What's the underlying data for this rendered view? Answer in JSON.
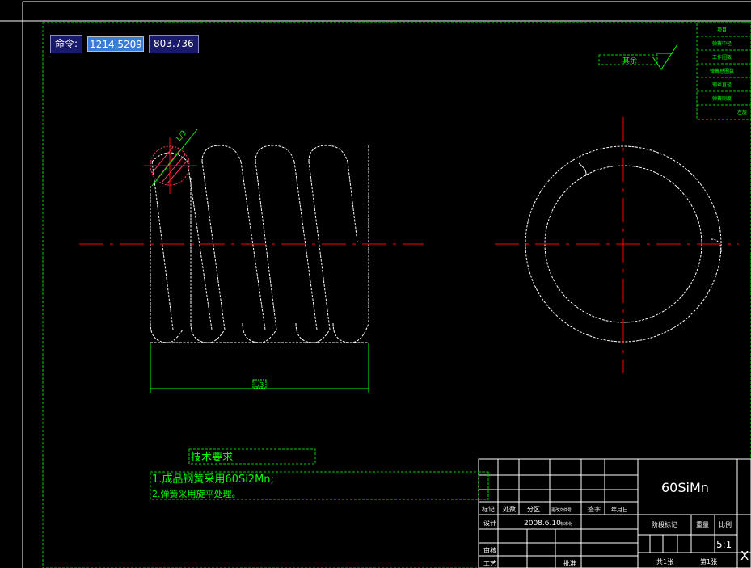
{
  "command": {
    "label": "命令:",
    "x_value": "1214.5209",
    "y_value": "803.736"
  },
  "colors": {
    "background": "#000000",
    "outline": "#ffffff",
    "dimension": "#00ff00",
    "centerline": "#ff0000",
    "hatch": "#ff3366",
    "selection_box": "#3a7bd5"
  },
  "drawing": {
    "pitch_label": "L/3",
    "width_label": "L/3",
    "roughness_label": "其余",
    "tech_req_title": "技术要求",
    "tech_req_items": [
      "1.成品钢簧采用60Si2Mn;",
      "2.弹簧采用旋平处理。"
    ]
  },
  "corner_table": {
    "rows": [
      "项目",
      "弹簧中径",
      "工作圈数",
      "弹簧总圈数",
      "钢丝直径",
      "弹簧刚度",
      "左旋"
    ]
  },
  "title_block": {
    "material": "60SiMn",
    "scale": "5:1",
    "labels": [
      "标记",
      "处数",
      "分区",
      "更改文件号",
      "签字",
      "年月日"
    ],
    "design": "设计",
    "date": "2008.6.10",
    "standard": "标准化",
    "check": "审核",
    "process": "工艺",
    "approve": "批准",
    "stage_mark": "阶段标记",
    "weight": "重量",
    "ratio": "比例",
    "sheets_total": "共1张",
    "sheet_no": "第1张",
    "x_char": "X"
  }
}
